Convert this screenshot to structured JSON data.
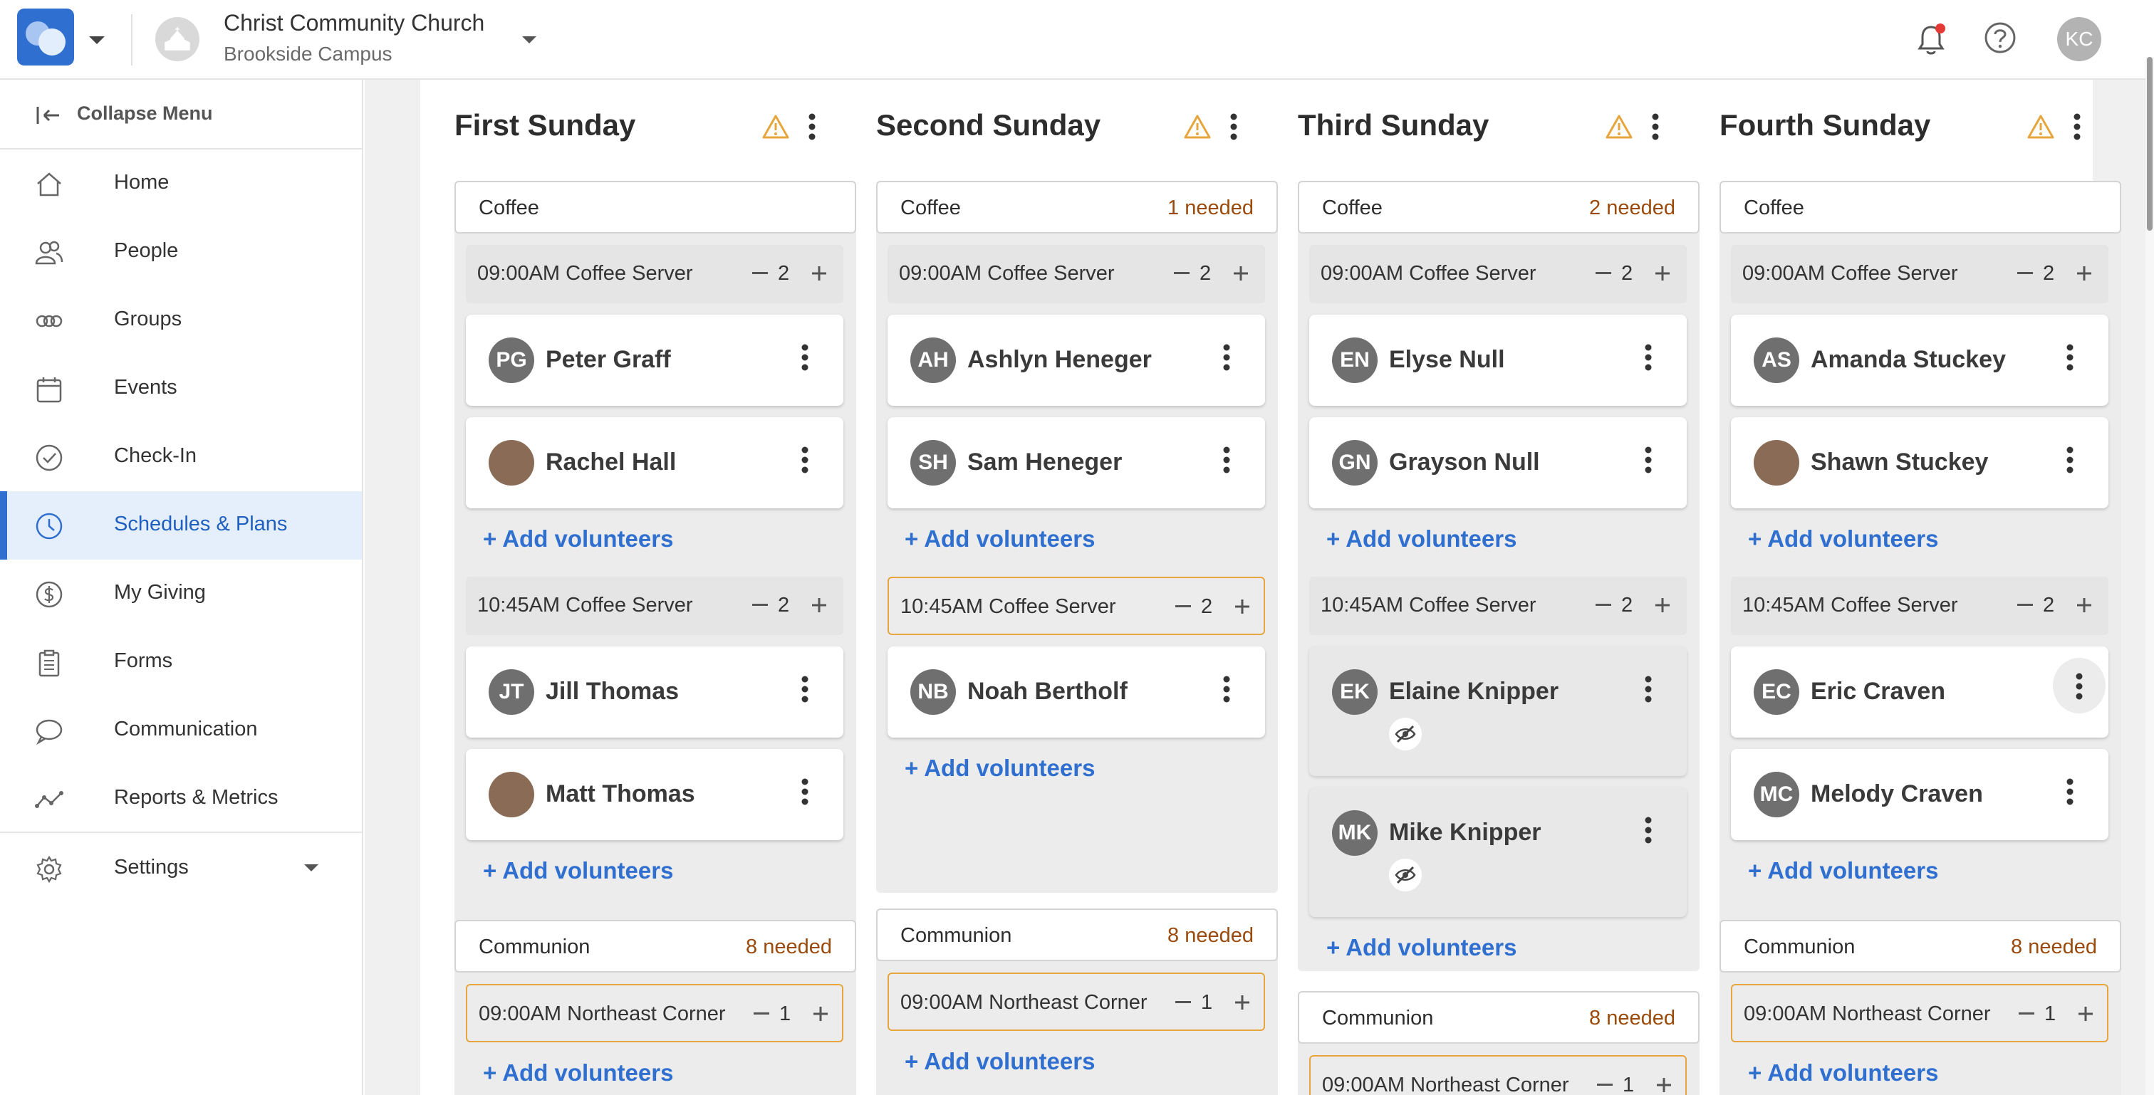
{
  "header": {
    "church_name": "Christ Community Church",
    "campus_name": "Brookside Campus",
    "user_initials": "KC",
    "notification_color": "#e53935"
  },
  "sidebar": {
    "collapse_label": "Collapse Menu",
    "items": [
      {
        "label": "Home",
        "icon": "home-icon"
      },
      {
        "label": "People",
        "icon": "people-icon"
      },
      {
        "label": "Groups",
        "icon": "groups-icon"
      },
      {
        "label": "Events",
        "icon": "calendar-icon"
      },
      {
        "label": "Check-In",
        "icon": "check-circle-icon"
      },
      {
        "label": "Schedules & Plans",
        "icon": "clock-icon",
        "active": true
      },
      {
        "label": "My Giving",
        "icon": "dollar-icon"
      },
      {
        "label": "Forms",
        "icon": "clipboard-icon"
      },
      {
        "label": "Communication",
        "icon": "chat-icon"
      },
      {
        "label": "Reports & Metrics",
        "icon": "metrics-icon"
      }
    ],
    "settings_label": "Settings"
  },
  "colors": {
    "accent": "#2f6fd0",
    "needed": "#9a4a0a",
    "warning": "#e7a53d"
  },
  "columns": [
    {
      "title": "First Sunday",
      "sections": [
        {
          "name": "Coffee",
          "needed": "",
          "slots": [
            {
              "time": "09:00AM Coffee Server",
              "count": "2",
              "volunteers": [
                {
                  "initials": "PG",
                  "name": "Peter Graff"
                },
                {
                  "initials": "",
                  "name": "Rachel Hall",
                  "photo": true
                }
              ],
              "add_label": "+ Add volunteers"
            },
            {
              "time": "10:45AM Coffee Server",
              "count": "2",
              "volunteers": [
                {
                  "initials": "JT",
                  "name": "Jill Thomas"
                },
                {
                  "initials": "",
                  "name": "Matt Thomas",
                  "photo": true
                }
              ],
              "add_label": "+ Add volunteers"
            }
          ]
        },
        {
          "name": "Communion",
          "needed": "8 needed",
          "slots": [
            {
              "time": "09:00AM Northeast Corner",
              "count": "1",
              "volunteers": [],
              "add_label": "+ Add volunteers"
            }
          ]
        }
      ]
    },
    {
      "title": "Second Sunday",
      "sections": [
        {
          "name": "Coffee",
          "needed": "1 needed",
          "slots": [
            {
              "time": "09:00AM Coffee Server",
              "count": "2",
              "volunteers": [
                {
                  "initials": "AH",
                  "name": "Ashlyn Heneger"
                },
                {
                  "initials": "SH",
                  "name": "Sam Heneger"
                }
              ],
              "add_label": "+ Add volunteers"
            },
            {
              "time": "10:45AM Coffee Server",
              "count": "2",
              "volunteers": [
                {
                  "initials": "NB",
                  "name": "Noah Bertholf"
                }
              ],
              "add_label": "+ Add volunteers"
            }
          ]
        },
        {
          "name": "Communion",
          "needed": "8 needed",
          "slots": [
            {
              "time": "09:00AM Northeast Corner",
              "count": "1",
              "volunteers": [],
              "add_label": "+ Add volunteers"
            }
          ]
        }
      ]
    },
    {
      "title": "Third Sunday",
      "sections": [
        {
          "name": "Coffee",
          "needed": "2 needed",
          "slots": [
            {
              "time": "09:00AM Coffee Server",
              "count": "2",
              "volunteers": [
                {
                  "initials": "EN",
                  "name": "Elyse Null"
                },
                {
                  "initials": "GN",
                  "name": "Grayson Null"
                }
              ],
              "add_label": "+ Add volunteers"
            },
            {
              "time": "10:45AM Coffee Server",
              "count": "2",
              "volunteers": [
                {
                  "initials": "EK",
                  "name": "Elaine Knipper",
                  "hidden": true
                },
                {
                  "initials": "MK",
                  "name": "Mike Knipper",
                  "hidden": true
                }
              ],
              "add_label": "+ Add volunteers"
            }
          ]
        },
        {
          "name": "Communion",
          "needed": "8 needed",
          "slots": [
            {
              "time": "09:00AM Northeast Corner",
              "count": "1",
              "volunteers": [],
              "add_label": ""
            }
          ]
        }
      ]
    },
    {
      "title": "Fourth Sunday",
      "sections": [
        {
          "name": "Coffee",
          "needed": "",
          "slots": [
            {
              "time": "09:00AM Coffee Server",
              "count": "2",
              "volunteers": [
                {
                  "initials": "AS",
                  "name": "Amanda Stuckey"
                },
                {
                  "initials": "",
                  "name": "Shawn Stuckey",
                  "photo": true
                }
              ],
              "add_label": "+ Add volunteers"
            },
            {
              "time": "10:45AM Coffee Server",
              "count": "2",
              "volunteers": [
                {
                  "initials": "EC",
                  "name": "Eric Craven"
                },
                {
                  "initials": "MC",
                  "name": "Melody Craven"
                }
              ],
              "add_label": "+ Add volunteers"
            }
          ]
        },
        {
          "name": "Communion",
          "needed": "8 needed",
          "slots": [
            {
              "time": "09:00AM Northeast Corner",
              "count": "1",
              "volunteers": [],
              "add_label": "+ Add volunteers"
            }
          ]
        }
      ]
    }
  ]
}
